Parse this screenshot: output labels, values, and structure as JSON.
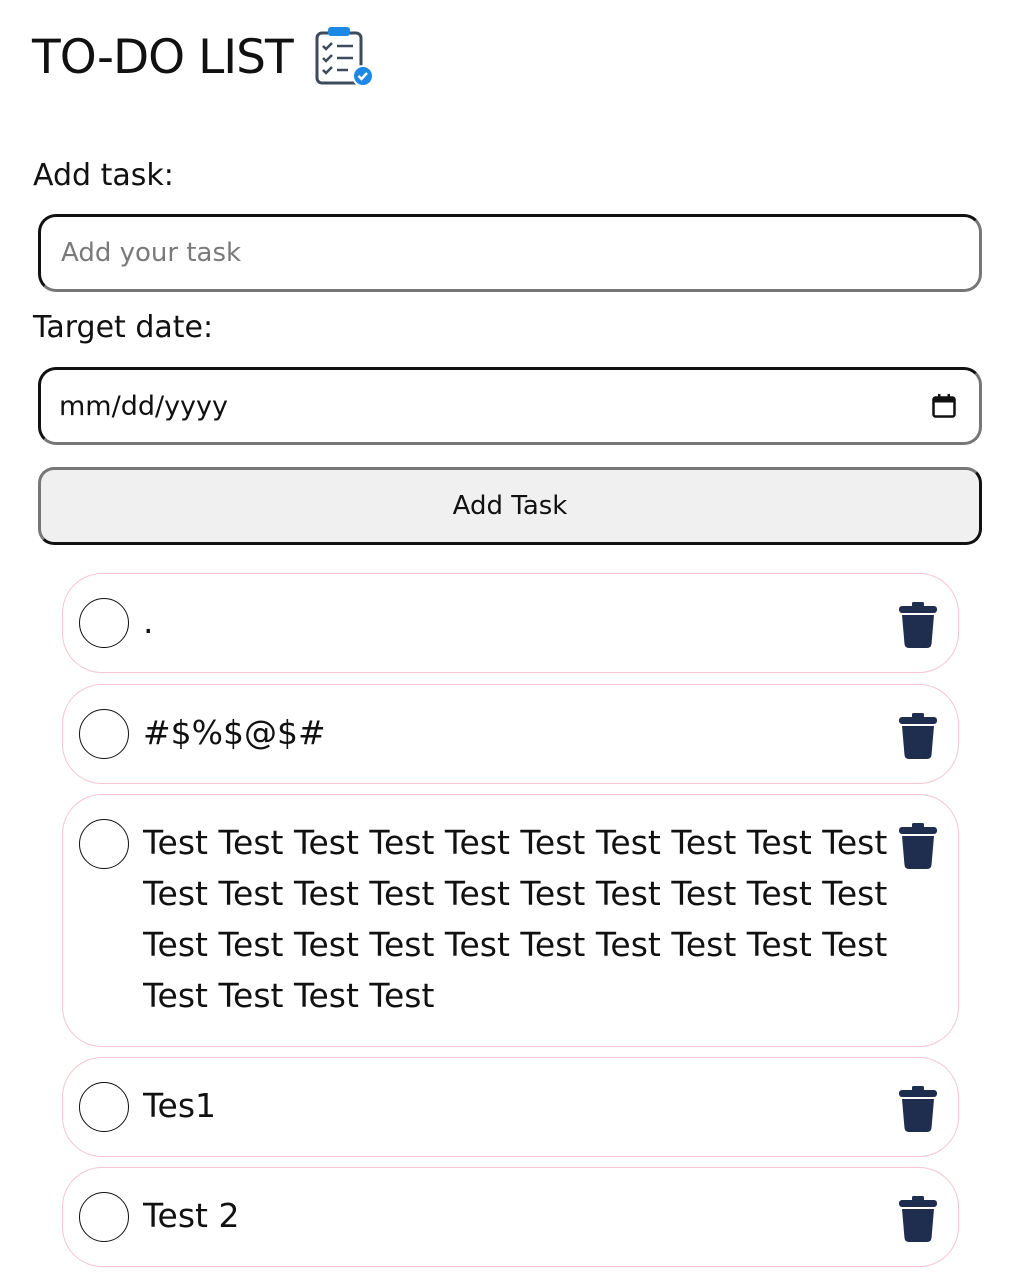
{
  "header": {
    "title": "TO-DO LIST",
    "icon": "clipboard-checklist-icon"
  },
  "form": {
    "task_label": "Add task:",
    "task_placeholder": "Add your task",
    "task_value": "",
    "date_label": "Target date:",
    "date_value": "mm/dd/yyyy",
    "date_icon": "calendar-icon",
    "add_button_label": "Add Task"
  },
  "tasks": [
    {
      "text": ".",
      "done": false
    },
    {
      "text": "#$%$@$#",
      "done": false
    },
    {
      "text": "Test Test Test Test Test Test Test Test Test Test Test Test Test Test Test Test Test Test Test Test Test Test Test Test Test Test Test Test Test Test Test Test Test Test",
      "done": false
    },
    {
      "text": "Tes1",
      "done": false
    },
    {
      "text": "Test 2",
      "done": false
    }
  ],
  "colors": {
    "accent_blue": "#1e88e5",
    "trash_navy": "#1f2d4f",
    "task_border_pink": "#f5c6d0",
    "button_bg": "#f0f0f0"
  }
}
